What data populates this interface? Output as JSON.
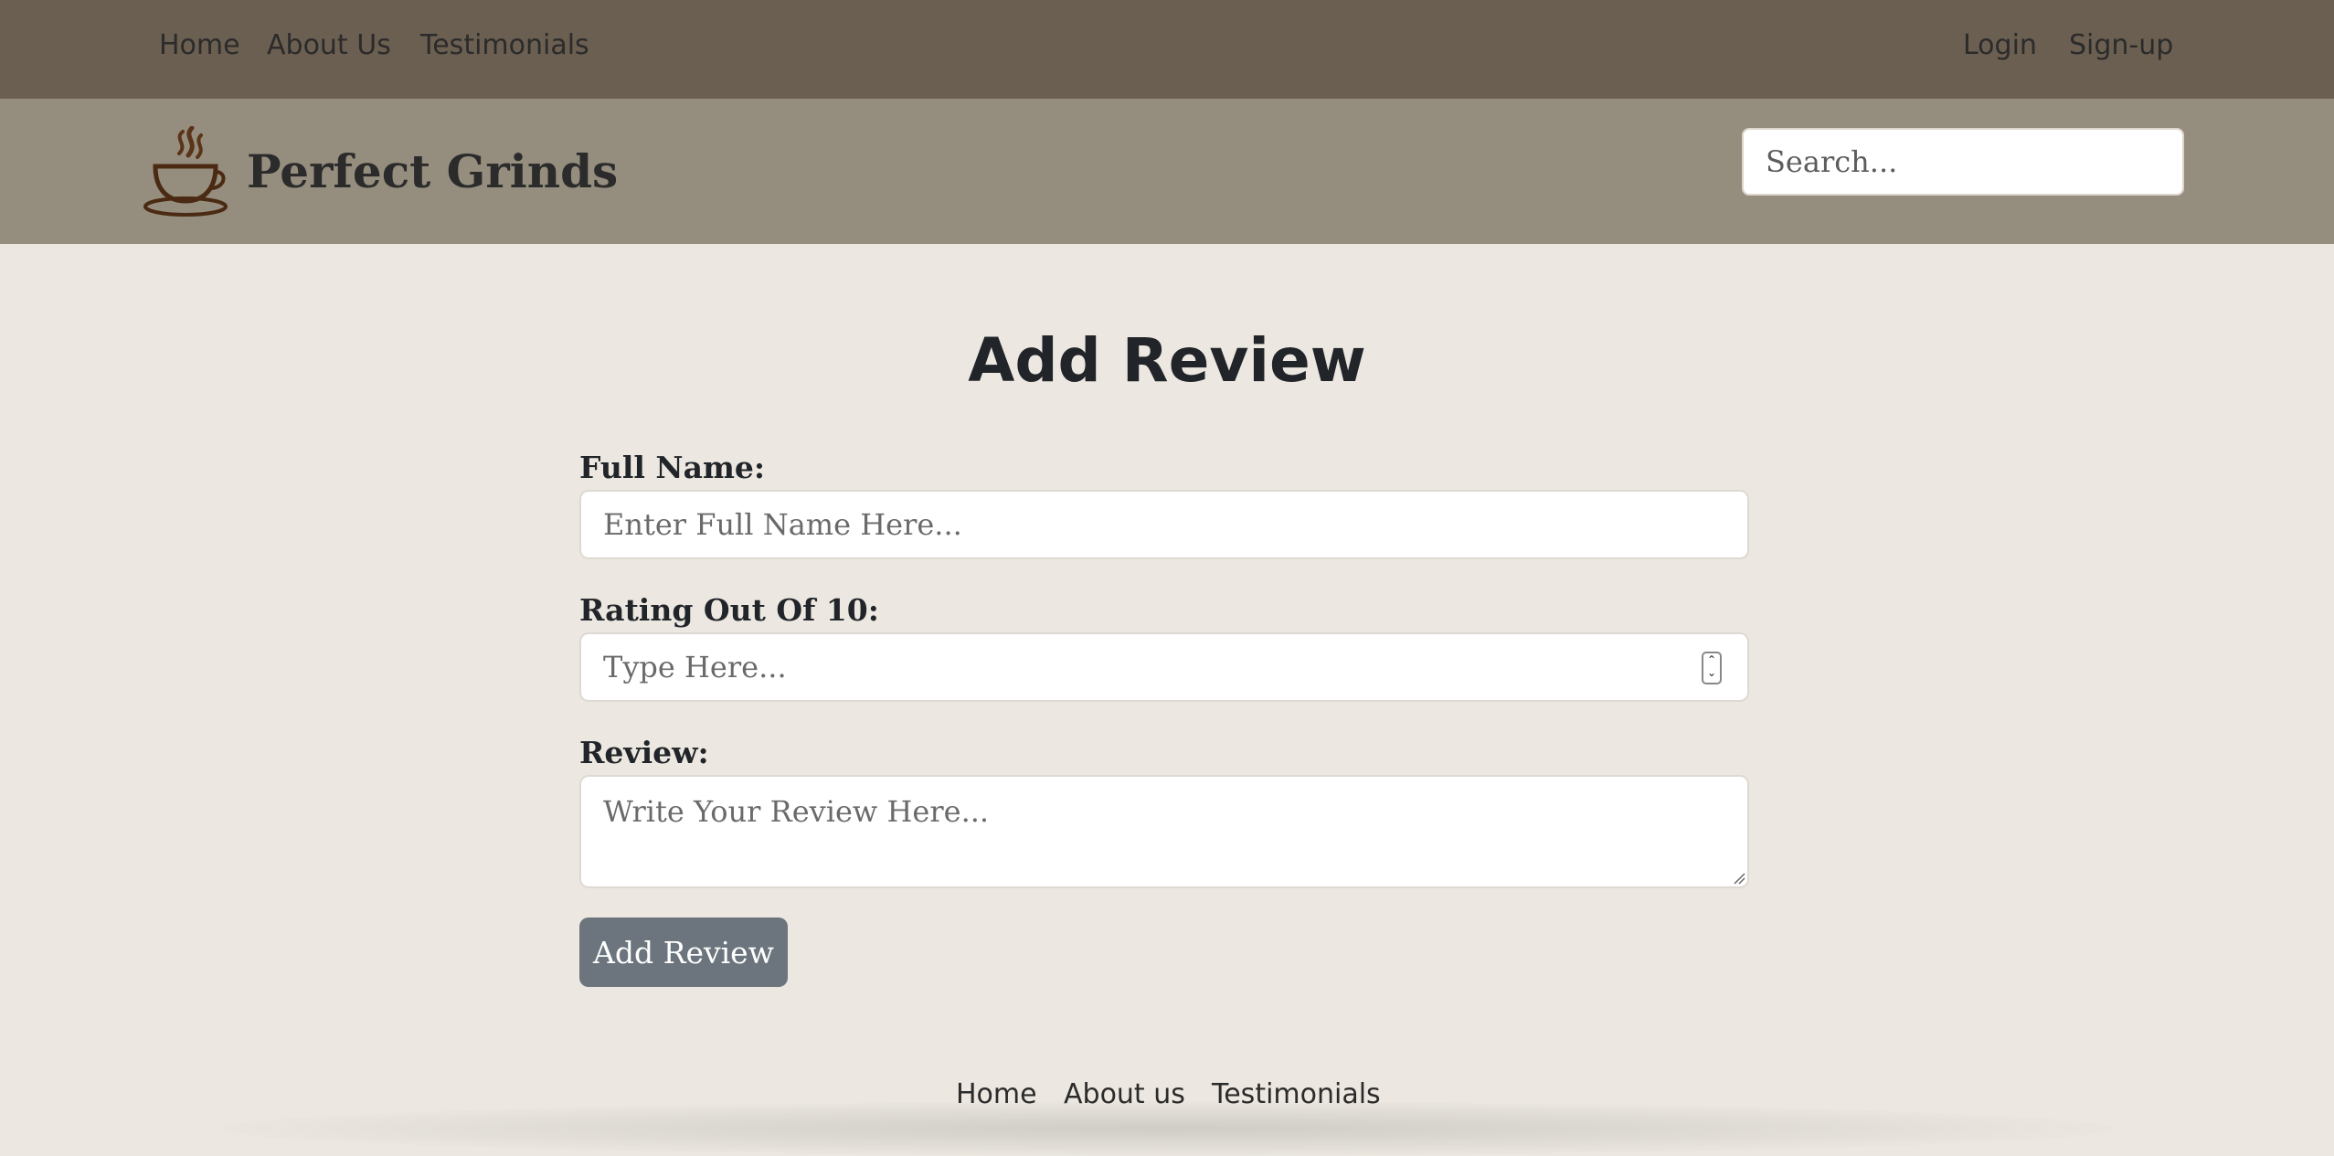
{
  "topnav": {
    "left": [
      "Home",
      "About Us",
      "Testimonials"
    ],
    "right": [
      "Login",
      "Sign-up"
    ]
  },
  "header": {
    "brand": "Perfect Grinds",
    "logo_icon": "coffee-cup-icon",
    "search_placeholder": "Search..."
  },
  "main": {
    "title": "Add Review",
    "form": {
      "name_label": "Full Name:",
      "name_placeholder": "Enter Full Name Here...",
      "rating_label": "Rating Out Of 10:",
      "rating_placeholder": "Type Here...",
      "review_label": "Review:",
      "review_placeholder": "Write Your Review Here...",
      "submit_label": "Add Review"
    }
  },
  "footer": {
    "links": [
      "Home",
      "About us",
      "Testimonials"
    ]
  },
  "colors": {
    "topbar": "#6b5f51",
    "header": "#958d7d",
    "page_bg": "#ece8e1",
    "button": "#6c757d"
  }
}
